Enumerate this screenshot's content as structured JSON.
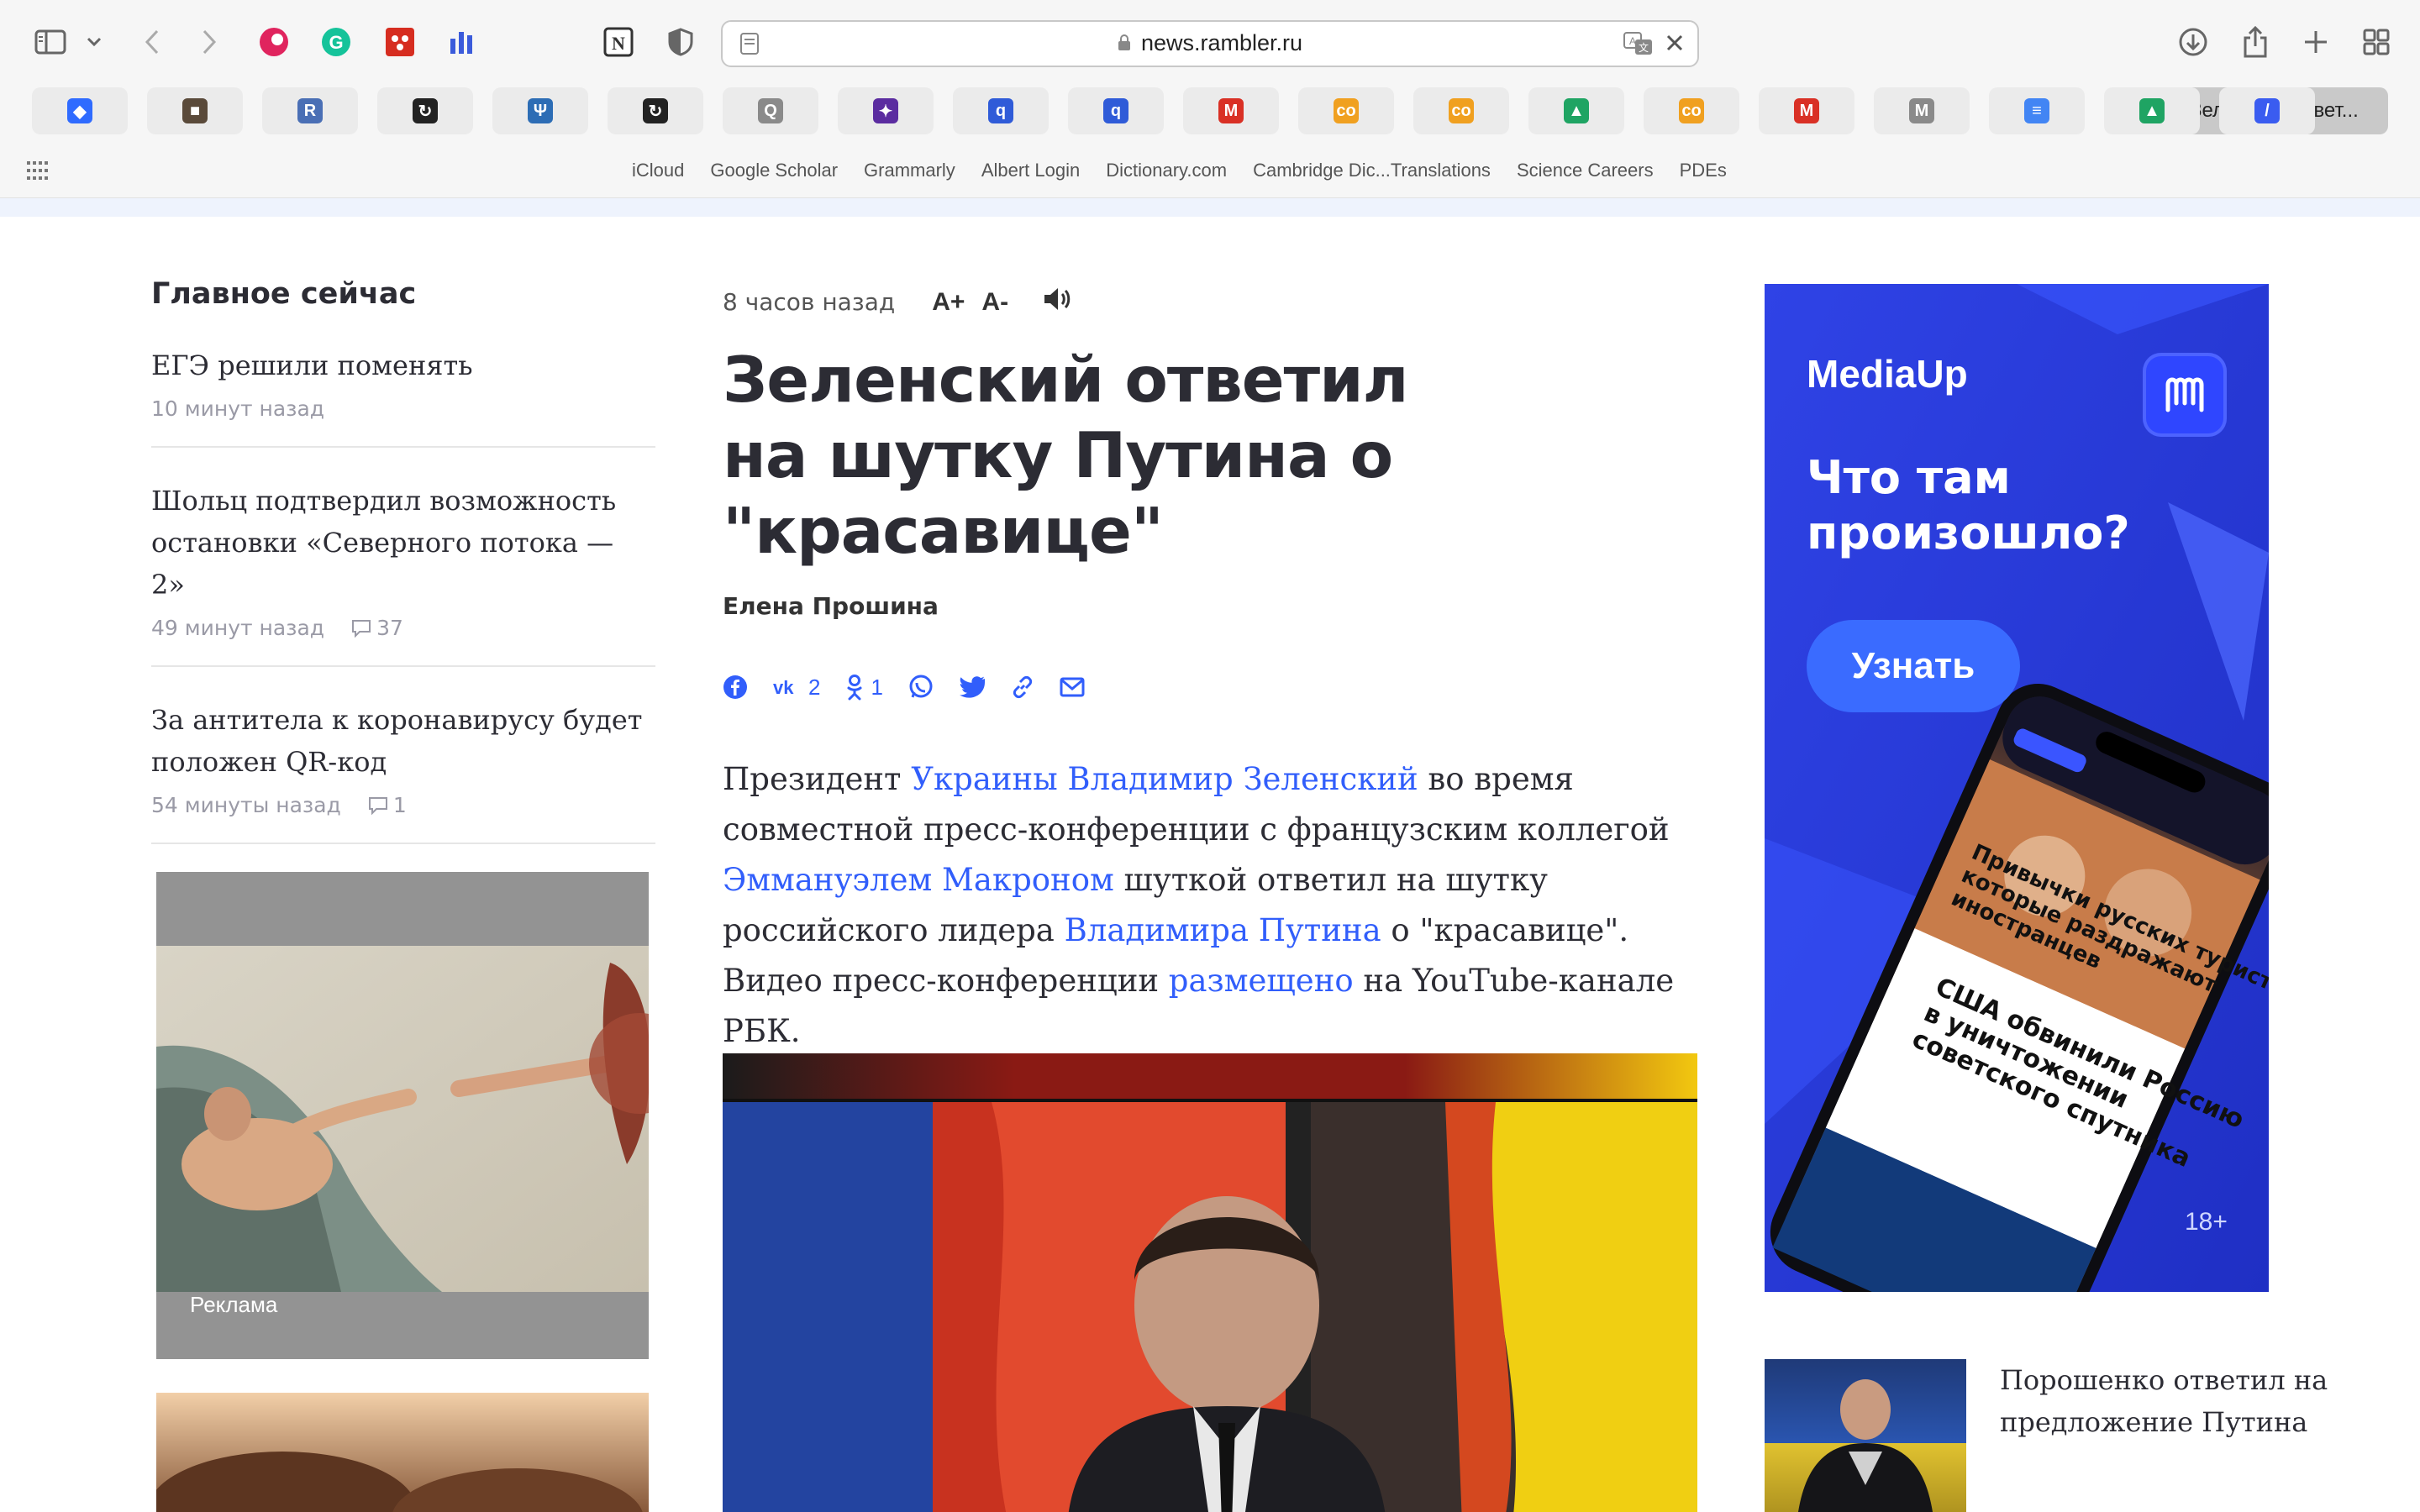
{
  "browser": {
    "url": "news.rambler.ru",
    "active_tab_title": "Зеленский ответ...",
    "favorites": [
      "iCloud",
      "Google Scholar",
      "Grammarly",
      "Albert Login",
      "Dictionary.com",
      "Cambridge Dic...Translations",
      "Science Careers",
      "PDEs"
    ],
    "pinned_tabs": [
      {
        "icon": "blue-diamond-icon",
        "color": "#2f6bff",
        "glyph": "◆"
      },
      {
        "icon": "photo-thumb-icon",
        "color": "#5a4a3a",
        "glyph": "■"
      },
      {
        "icon": "r-logo-icon",
        "color": "#4a6fb5",
        "glyph": "R"
      },
      {
        "icon": "spinner-icon",
        "color": "#222222",
        "glyph": "↻"
      },
      {
        "icon": "psi-icon",
        "color": "#2d6db5",
        "glyph": "Ψ"
      },
      {
        "icon": "spinner-icon",
        "color": "#222222",
        "glyph": "↻"
      },
      {
        "icon": "q-icon",
        "color": "#8a8a8a",
        "glyph": "Q"
      },
      {
        "icon": "purple-icon",
        "color": "#5b2ca0",
        "glyph": "✦"
      },
      {
        "icon": "q-blue-icon",
        "color": "#2f5bd8",
        "glyph": "q"
      },
      {
        "icon": "q-blue-icon",
        "color": "#2f5bd8",
        "glyph": "q"
      },
      {
        "icon": "gmail-icon",
        "color": "#d93025",
        "glyph": "M"
      },
      {
        "icon": "co-icon",
        "color": "#f0a020",
        "glyph": "co"
      },
      {
        "icon": "co-icon",
        "color": "#f0a020",
        "glyph": "co"
      },
      {
        "icon": "drive-icon",
        "color": "#1fa463",
        "glyph": "▲"
      },
      {
        "icon": "co-icon",
        "color": "#f0a020",
        "glyph": "co"
      },
      {
        "icon": "gmail-icon",
        "color": "#d93025",
        "glyph": "M"
      },
      {
        "icon": "m-gray-icon",
        "color": "#8a8a8a",
        "glyph": "M"
      },
      {
        "icon": "docs-icon",
        "color": "#4285f4",
        "glyph": "≡"
      },
      {
        "icon": "drive-icon",
        "color": "#1fa463",
        "glyph": "▲"
      },
      {
        "icon": "slash-icon",
        "color": "#3a5cf0",
        "glyph": "/"
      }
    ]
  },
  "left": {
    "section_title": "Главное сейчас",
    "items": [
      {
        "title": "ЕГЭ решили поменять",
        "time": "10 минут назад",
        "comments": ""
      },
      {
        "title": "Шольц подтвердил возможность остановки «Северного потока — 2»",
        "time": "49 минут назад",
        "comments": "37"
      },
      {
        "title": "За антитела к коронавирусу будет положен QR-код",
        "time": "54 минуты назад",
        "comments": "1"
      }
    ],
    "ad_label": "Реклама"
  },
  "article": {
    "time": "8 часов назад",
    "font_up": "A+",
    "font_down": "A-",
    "headline": "Зеленский ответил на шутку Путина о \"красавице\"",
    "author": "Елена Прошина",
    "share": {
      "vk_count": "2",
      "ok_count": "1"
    },
    "lead": {
      "p1": "Президент ",
      "l1": "Украины Владимир Зеленский",
      "p2": " во время совместной пресс-конференции с французским коллегой ",
      "l2": "Эммануэлем Макроном",
      "p3": " шуткой ответил на шутку российского лидера ",
      "l3": "Владимира Путина",
      "p4": " о \"красавице\". Видео пресс-конференции ",
      "l4": "размещено",
      "p5": " на YouTube-канале РБК."
    }
  },
  "right": {
    "banner": {
      "brand": "MediaUp",
      "headline": "Что там произошло?",
      "button": "Узнать",
      "age": "18+",
      "phone_text_1": "Привычки русских туристов, которые раздражают иностранцев",
      "phone_text_2": "США обвинили Россию в уничтожении советского спутника"
    },
    "side_news_title": "Порошенко ответил на предложение Путина"
  },
  "colors": {
    "link": "#315efb",
    "accent_bg": "#eef3fd",
    "banner": "#2a3bdc"
  }
}
